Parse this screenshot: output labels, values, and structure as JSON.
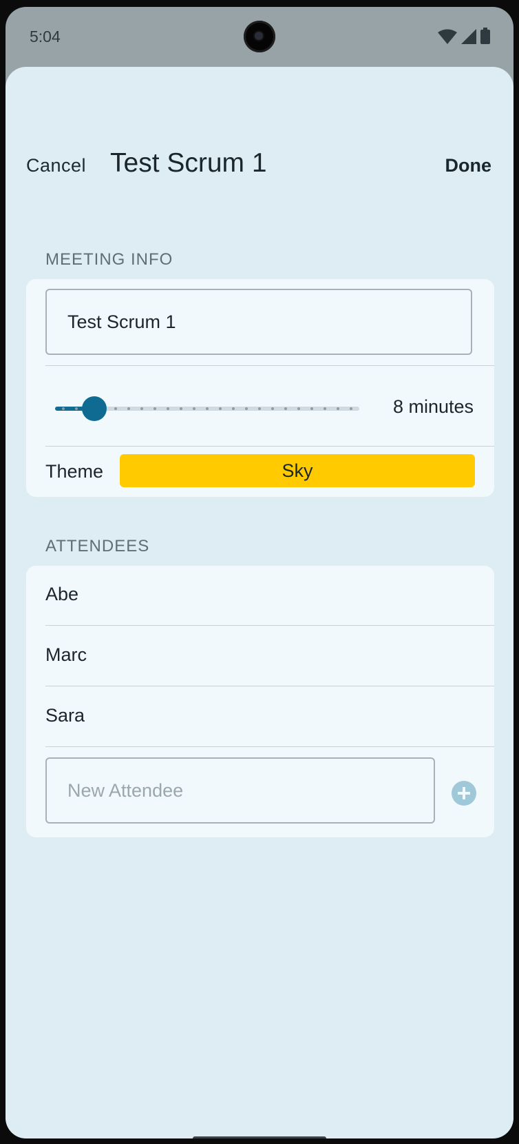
{
  "status_bar": {
    "time": "5:04"
  },
  "nav": {
    "cancel_label": "Cancel",
    "title": "Test Scrum 1",
    "done_label": "Done"
  },
  "meeting_info": {
    "header": "MEETING INFO",
    "title_value": "Test Scrum 1",
    "length_minutes": 8,
    "length_label": "8 minutes",
    "slider_fraction": 0.13,
    "theme_label": "Theme",
    "theme_value": "Sky",
    "theme_color": "#ffca00"
  },
  "attendees": {
    "header": "ATTENDEES",
    "items": [
      "Abe",
      "Marc",
      "Sara"
    ],
    "new_placeholder": "New Attendee"
  },
  "icons": {
    "wifi": "wifi-icon",
    "signal": "cell-signal-icon",
    "battery": "battery-icon",
    "add": "plus-circle-icon"
  },
  "colors": {
    "accent": "#0f6b92",
    "background": "#ddedf3",
    "card": "#f1f9fd"
  }
}
